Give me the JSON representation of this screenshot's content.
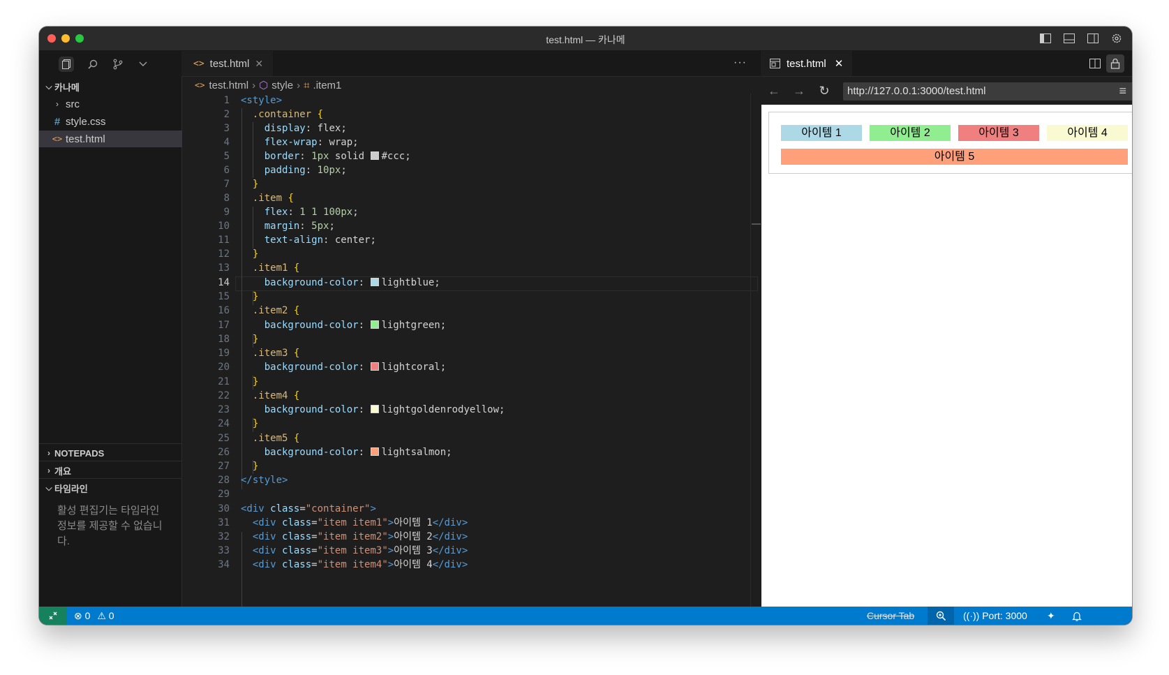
{
  "window": {
    "title": "test.html — 카나메"
  },
  "explorer": {
    "root": "카나메",
    "items": [
      {
        "label": "src",
        "icon": "chevron-right-icon"
      },
      {
        "label": "style.css",
        "icon": "hash-icon"
      },
      {
        "label": "test.html",
        "icon": "html-icon",
        "selected": true
      }
    ],
    "sections": [
      "NOTEPADS",
      "개요",
      "타임라인"
    ],
    "timeline_message": "활성 편집기는 타임라인 정보를 제공할 수 없습니다."
  },
  "editor": {
    "tab_label": "test.html",
    "breadcrumb": [
      "test.html",
      "style",
      ".item1"
    ],
    "current_line": 14,
    "line_numbers": [
      "1",
      "2",
      "3",
      "4",
      "5",
      "6",
      "7",
      "8",
      "9",
      "10",
      "11",
      "12",
      "13",
      "14",
      "15",
      "16",
      "17",
      "18",
      "19",
      "20",
      "21",
      "22",
      "23",
      "24",
      "25",
      "26",
      "27",
      "28",
      "29",
      "30",
      "31",
      "32",
      "33",
      "34"
    ],
    "code": {
      "l1": "<style>",
      "l2_sel": ".container",
      "brace_open": "{",
      "brace_close": "}",
      "display": "display",
      "flex": "flex",
      "flex_wrap": "flex-wrap",
      "wrap": "wrap",
      "border": "border",
      "n1px": "1px",
      "solid": "solid",
      "ccc": "#ccc",
      "padding": "padding",
      "n10px": "10px",
      "item_sel": ".item",
      "flex_prop": "flex",
      "n1a": "1",
      "n1b": "1",
      "n100px": "100px",
      "margin": "margin",
      "n5px": "5px",
      "text_align": "text-align",
      "center": "center",
      "item1_sel": ".item1",
      "bg": "background-color",
      "lightblue": "lightblue",
      "item2_sel": ".item2",
      "lightgreen": "lightgreen",
      "item3_sel": ".item3",
      "lightcoral": "lightcoral",
      "item4_sel": ".item4",
      "lightgoldenrodyellow": "lightgoldenrodyellow",
      "item5_sel": ".item5",
      "lightsalmon": "lightsalmon",
      "l28": "</style>",
      "div_open": "<div",
      "class_attr": "class",
      "eq": "=",
      "container_val": "\"container\"",
      "gt": ">",
      "i1_val": "\"item item1\"",
      "i1_text": "아이템 1",
      "i2_val": "\"item item2\"",
      "i2_text": "아이템 2",
      "i3_val": "\"item item3\"",
      "i3_text": "아이템 3",
      "i4_val": "\"item item4\"",
      "i4_text": "아이템 4",
      "div_close": "</div>"
    }
  },
  "preview": {
    "tab_label": "test.html",
    "url": "http://127.0.0.1:3000/test.html",
    "items": [
      {
        "label": "아이템 1",
        "color": "#add8e6"
      },
      {
        "label": "아이템 2",
        "color": "#90ee90"
      },
      {
        "label": "아이템 3",
        "color": "#f08080"
      },
      {
        "label": "아이템 4",
        "color": "#fafad2"
      },
      {
        "label": "아이템 5",
        "color": "#ffa07a"
      }
    ]
  },
  "statusbar": {
    "errors": "0",
    "warnings": "0",
    "cursor_tab": "Cursor Tab",
    "port": "Port: 3000"
  },
  "colors": {
    "accent": "#007acc",
    "remote": "#16825d"
  }
}
